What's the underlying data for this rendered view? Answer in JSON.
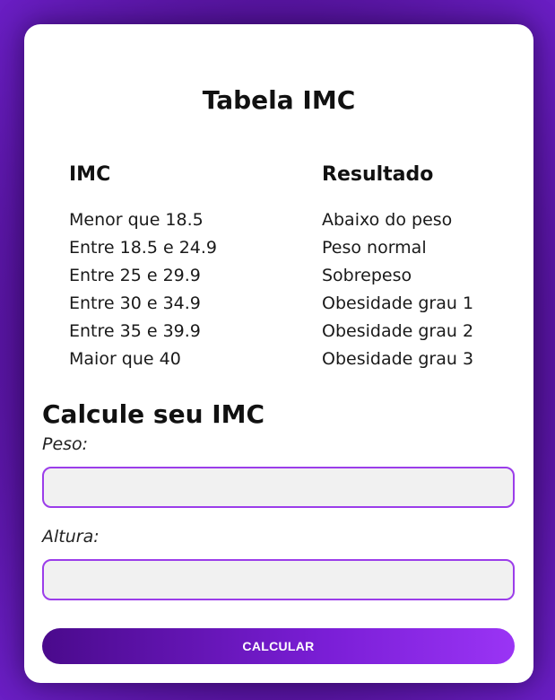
{
  "table": {
    "title": "Tabela IMC",
    "col_imc": "IMC",
    "col_result": "Resultado",
    "rows": [
      {
        "imc": "Menor que 18.5",
        "result": "Abaixo do peso"
      },
      {
        "imc": "Entre 18.5 e 24.9",
        "result": "Peso normal"
      },
      {
        "imc": "Entre 25 e 29.9",
        "result": "Sobrepeso"
      },
      {
        "imc": "Entre 30 e 34.9",
        "result": "Obesidade grau 1"
      },
      {
        "imc": "Entre 35 e 39.9",
        "result": "Obesidade grau 2"
      },
      {
        "imc": "Maior que 40",
        "result": "Obesidade grau 3"
      }
    ]
  },
  "form": {
    "title": "Calcule seu IMC",
    "weight_label": "Peso:",
    "weight_value": "",
    "height_label": "Altura:",
    "height_value": "",
    "button_label": "CALCULAR"
  },
  "colors": {
    "accent": "#9b3dea",
    "button_start": "#4a0a8c",
    "button_end": "#9a34f5",
    "background": "#4c0f8a"
  }
}
